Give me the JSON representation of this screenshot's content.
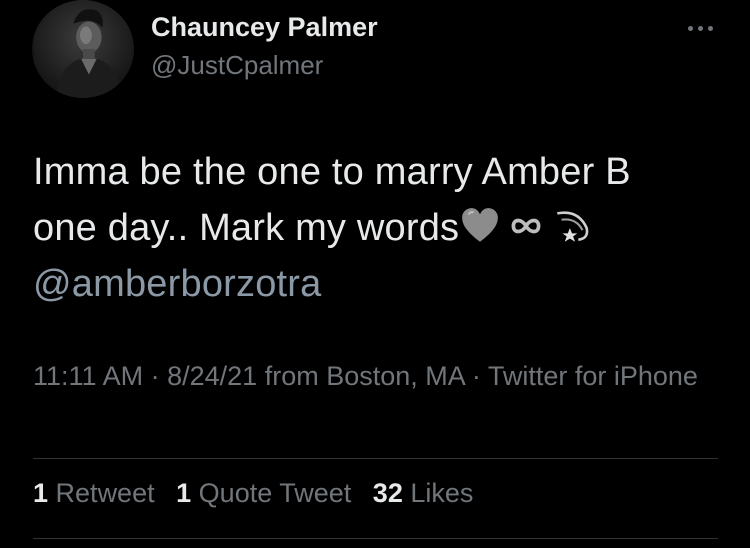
{
  "user": {
    "name": "Chauncey Palmer",
    "handle": "@JustCpalmer"
  },
  "tweet": {
    "line1": "Imma be the one to marry Amber B",
    "line2": "one day.. Mark my words",
    "emojis": [
      "grey-heart-icon",
      "infinity-icon",
      "dizzy-star-icon"
    ],
    "mention": "@amberborzotra"
  },
  "meta": {
    "time": "11:11 AM",
    "date": "8/24/21",
    "location": "from Boston, MA",
    "source": "Twitter for iPhone",
    "separator": "·"
  },
  "stats": {
    "retweets_count": "1",
    "retweets_label": "Retweet",
    "quotes_count": "1",
    "quotes_label": "Quote Tweet",
    "likes_count": "32",
    "likes_label": "Likes"
  },
  "colors": {
    "background": "#000000",
    "text": "#e7e9ea",
    "secondary": "#71767b",
    "divider": "#2f3336"
  }
}
